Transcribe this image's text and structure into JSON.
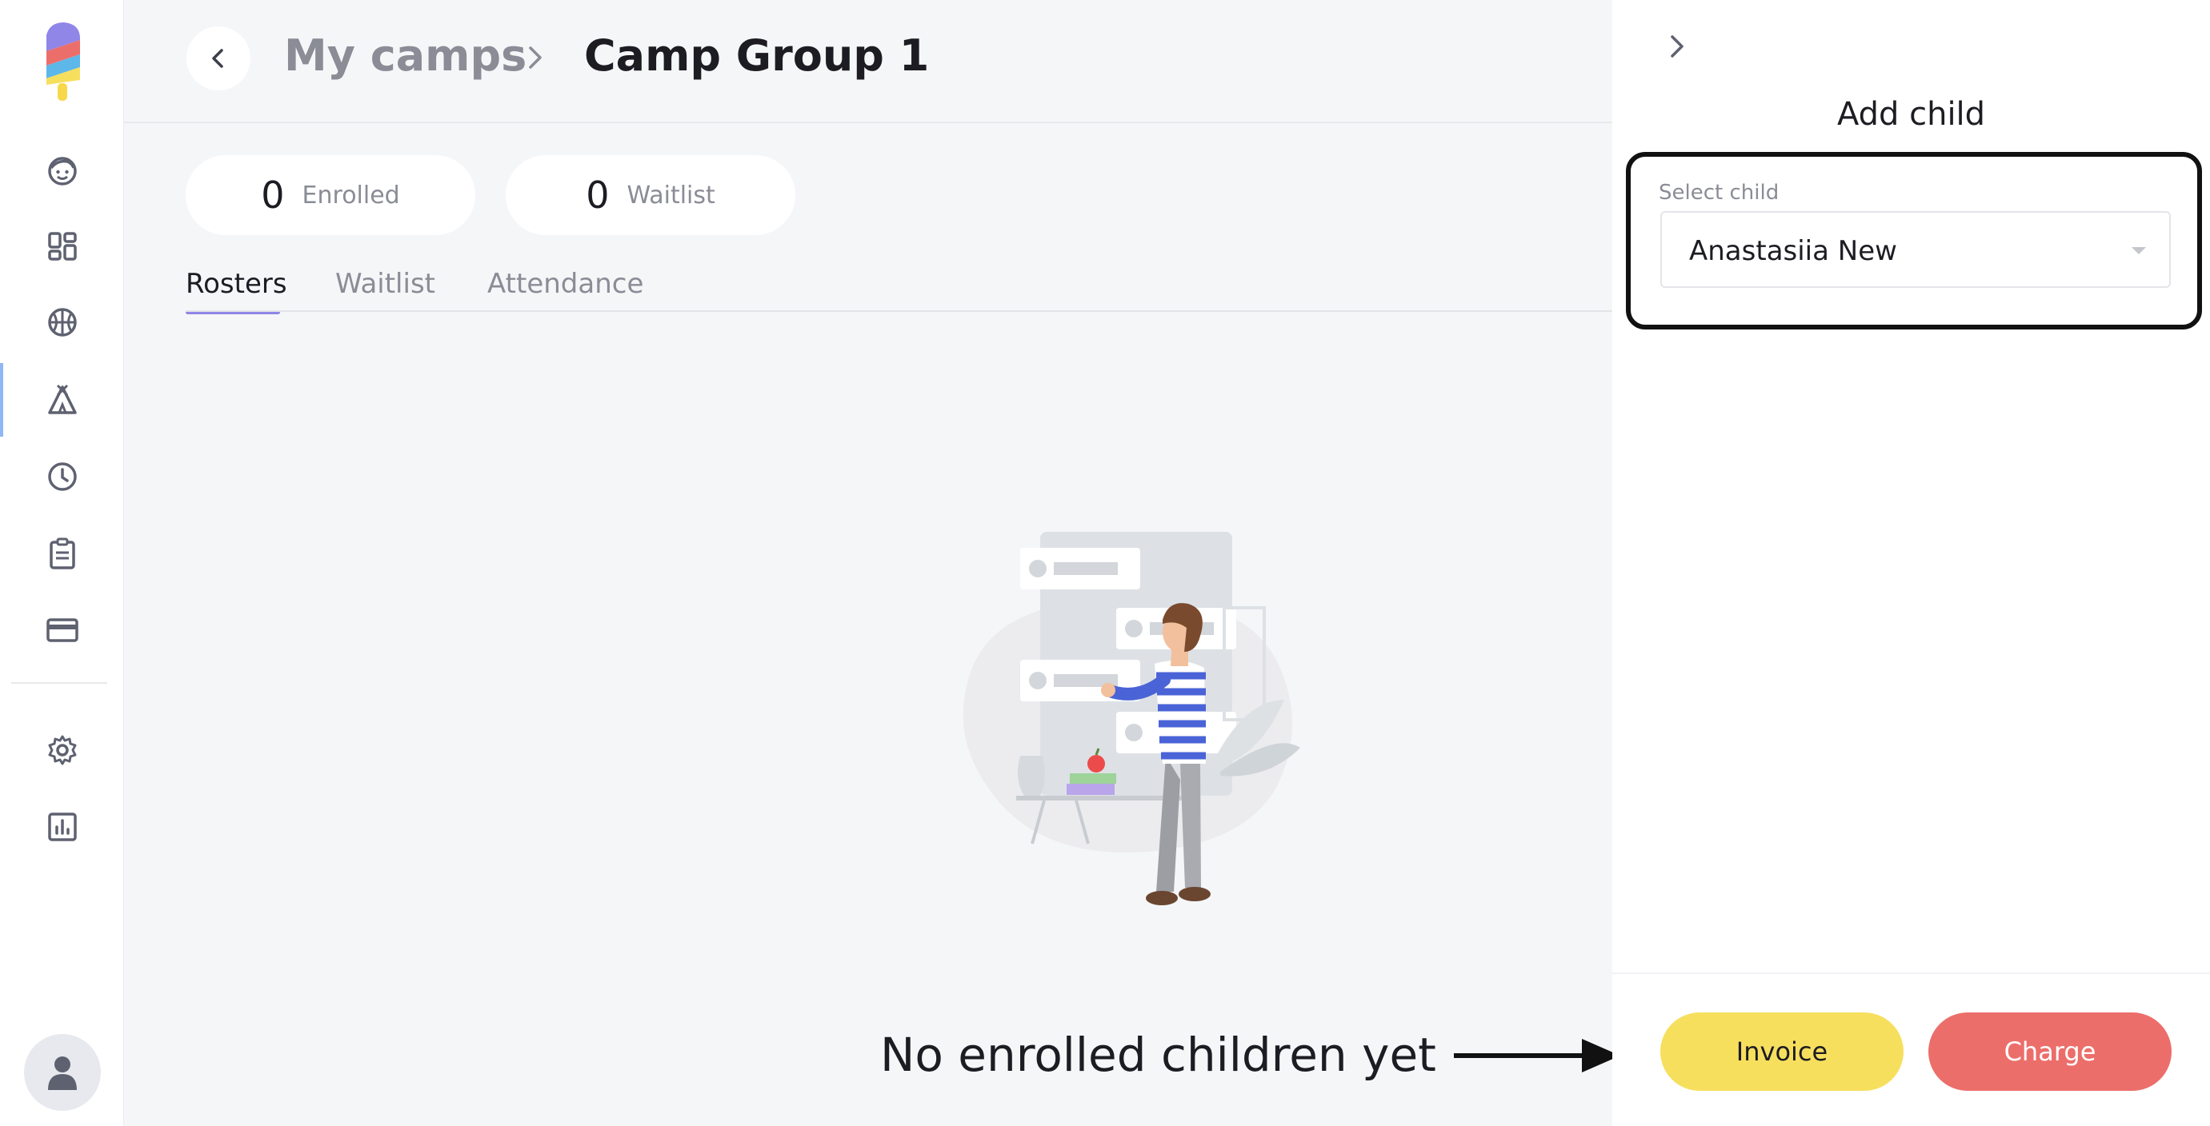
{
  "header": {
    "breadcrumb_parent": "My camps",
    "breadcrumb_current": "Camp Group 1"
  },
  "stats": [
    {
      "count": "0",
      "label": "Enrolled"
    },
    {
      "count": "0",
      "label": "Waitlist"
    }
  ],
  "tabs": [
    {
      "label": "Rosters",
      "active": true
    },
    {
      "label": "Waitlist",
      "active": false
    },
    {
      "label": "Attendance",
      "active": false
    }
  ],
  "empty_state": {
    "message": "No enrolled children yet"
  },
  "panel": {
    "title": "Add child",
    "field_label": "Select child",
    "selected_child": "Anastasiia New",
    "invoice_label": "Invoice",
    "charge_label": "Charge"
  },
  "sidebar": {
    "items": [
      {
        "icon": "child-face-icon"
      },
      {
        "icon": "dashboard-icon"
      },
      {
        "icon": "basketball-icon"
      },
      {
        "icon": "tent-icon",
        "active": true
      },
      {
        "icon": "clock-icon"
      },
      {
        "icon": "clipboard-icon"
      },
      {
        "icon": "credit-card-icon"
      },
      {
        "icon": "gear-icon"
      },
      {
        "icon": "report-chart-icon"
      }
    ]
  },
  "colors": {
    "accent_tab": "#8f86e8",
    "invoice": "#f7df5e",
    "charge": "#ec6e6a",
    "active_nav": "#8fb6f5"
  }
}
